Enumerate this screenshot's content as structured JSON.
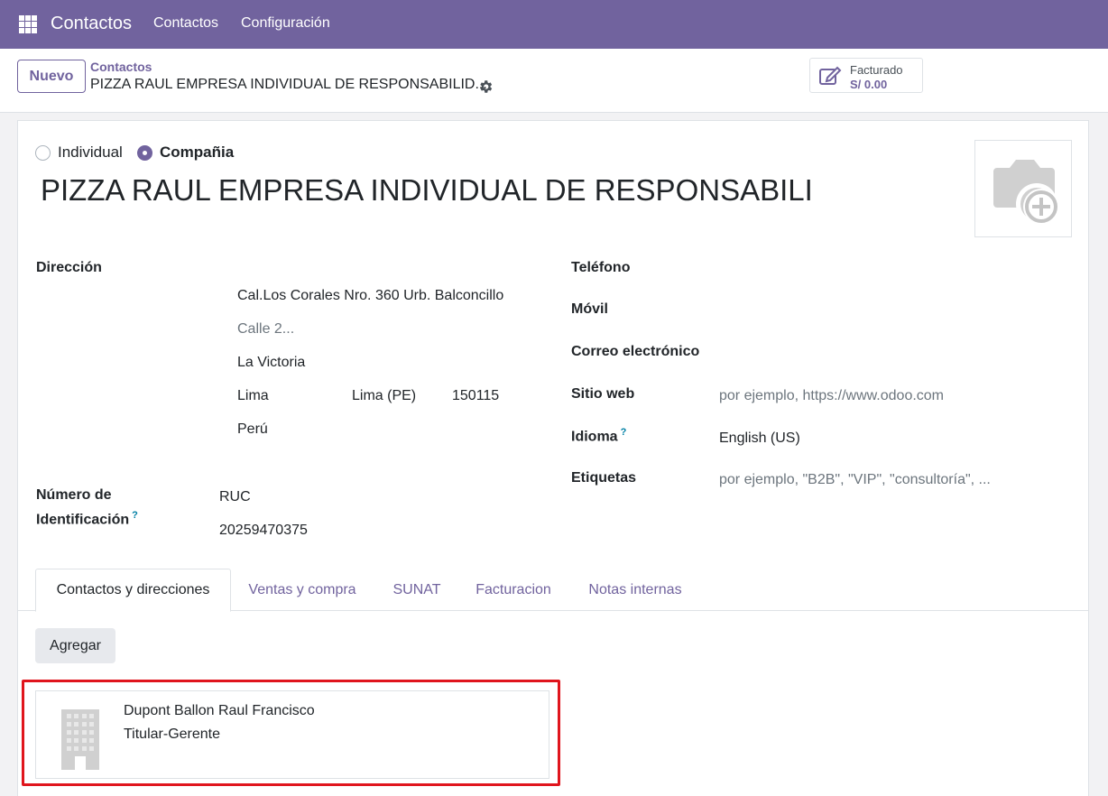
{
  "navbar": {
    "app_title": "Contactos",
    "menu": [
      "Contactos",
      "Configuración"
    ]
  },
  "control_panel": {
    "new_label": "Nuevo",
    "breadcrumb_parent": "Contactos",
    "breadcrumb_current": "PIZZA RAUL EMPRESA INDIVIDUAL DE RESPONSABILID...",
    "stat_button": {
      "label": "Facturado",
      "value": "S/ 0.00"
    }
  },
  "form": {
    "type_options": [
      {
        "label": "Individual",
        "checked": false
      },
      {
        "label": "Compañia",
        "checked": true
      }
    ],
    "name": "PIZZA RAUL EMPRESA INDIVIDUAL DE RESPONSABILIDAD",
    "address": {
      "label": "Dirección",
      "street": "Cal.Los Corales Nro. 360 Urb. Balconcillo",
      "street2_placeholder": "Calle 2...",
      "district": "La Victoria",
      "city": "Lima",
      "state": "Lima (PE)",
      "zip": "150115",
      "country": "Perú"
    },
    "identification": {
      "label_line1": "Número de",
      "label_line2": "Identificación",
      "help": "?",
      "type": "RUC",
      "number": "20259470375"
    },
    "phone_label": "Teléfono",
    "mobile_label": "Móvil",
    "email_label": "Correo electrónico",
    "website": {
      "label": "Sitio web",
      "placeholder": "por ejemplo, https://www.odoo.com"
    },
    "language": {
      "label": "Idioma",
      "help": "?",
      "value": "English (US)"
    },
    "tags": {
      "label": "Etiquetas",
      "placeholder": "por ejemplo, \"B2B\", \"VIP\", \"consultoría\", ..."
    }
  },
  "tabs": [
    {
      "label": "Contactos y direcciones",
      "active": true
    },
    {
      "label": "Ventas y compra",
      "active": false
    },
    {
      "label": "SUNAT",
      "active": false
    },
    {
      "label": "Facturacion",
      "active": false
    },
    {
      "label": "Notas internas",
      "active": false
    }
  ],
  "contacts_tab": {
    "add_label": "Agregar",
    "cards": [
      {
        "name": "Dupont Ballon Raul Francisco",
        "function": "Titular-Gerente",
        "icon": "building-icon"
      }
    ]
  },
  "colors": {
    "brand": "#71639e",
    "highlight": "#e0151d",
    "help": "#0180a5"
  }
}
